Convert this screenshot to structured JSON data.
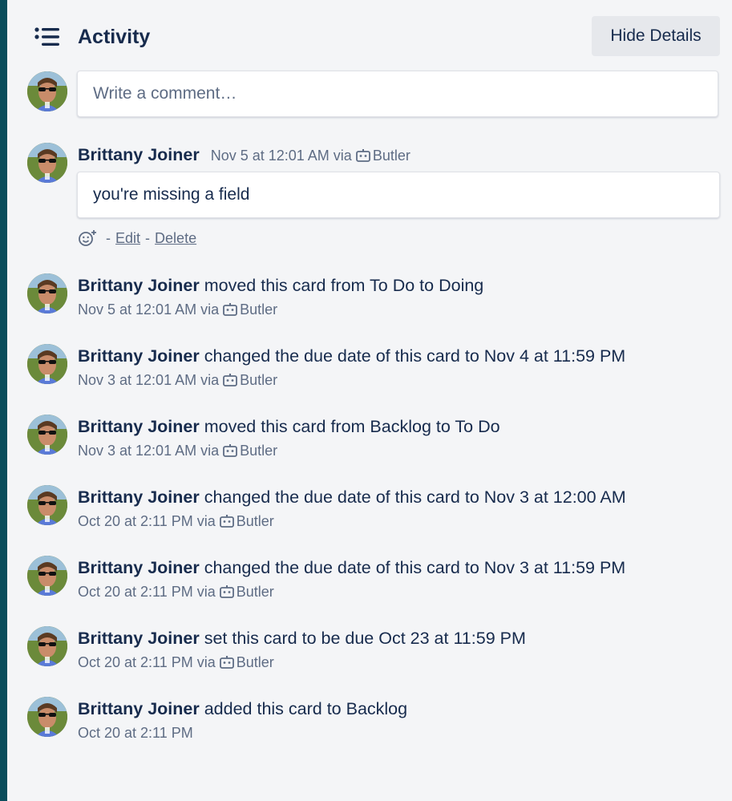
{
  "header": {
    "title": "Activity",
    "hide_details_label": "Hide Details",
    "icon": "activity-list-icon"
  },
  "comment_input": {
    "placeholder": "Write a comment…"
  },
  "comment": {
    "member": "Brittany Joiner",
    "timestamp": "Nov 5 at 12:01 AM via",
    "via": "Butler",
    "text": "you're missing a field",
    "actions": {
      "reaction_icon": "add-reaction-icon",
      "dash1": "-",
      "edit": "Edit",
      "dash2": "-",
      "delete": "Delete"
    }
  },
  "activities": [
    {
      "member": "Brittany Joiner",
      "action": "moved this card from To Do to Doing",
      "timestamp": "Nov 5 at 12:01 AM via",
      "via": "Butler"
    },
    {
      "member": "Brittany Joiner",
      "action": "changed the due date of this card to Nov 4 at 11:59 PM",
      "timestamp": "Nov 3 at 12:01 AM via",
      "via": "Butler"
    },
    {
      "member": "Brittany Joiner",
      "action": "moved this card from Backlog to To Do",
      "timestamp": "Nov 3 at 12:01 AM via",
      "via": "Butler"
    },
    {
      "member": "Brittany Joiner",
      "action": "changed the due date of this card to Nov 3 at 12:00 AM",
      "timestamp": "Oct 20 at 2:11 PM via",
      "via": "Butler"
    },
    {
      "member": "Brittany Joiner",
      "action": "changed the due date of this card to Nov 3 at 11:59 PM",
      "timestamp": "Oct 20 at 2:11 PM via",
      "via": "Butler"
    },
    {
      "member": "Brittany Joiner",
      "action": "set this card to be due Oct 23 at 11:59 PM",
      "timestamp": "Oct 20 at 2:11 PM via",
      "via": "Butler"
    },
    {
      "member": "Brittany Joiner",
      "action": "added this card to Backlog",
      "timestamp": "Oct 20 at 2:11 PM",
      "via": ""
    }
  ],
  "colors": {
    "sidebar_strip": "#0b4d5c",
    "background": "#f4f5f7",
    "text_primary": "#172b4d",
    "text_subtle": "#5e6c84",
    "button_bg": "#e6e8ec"
  }
}
